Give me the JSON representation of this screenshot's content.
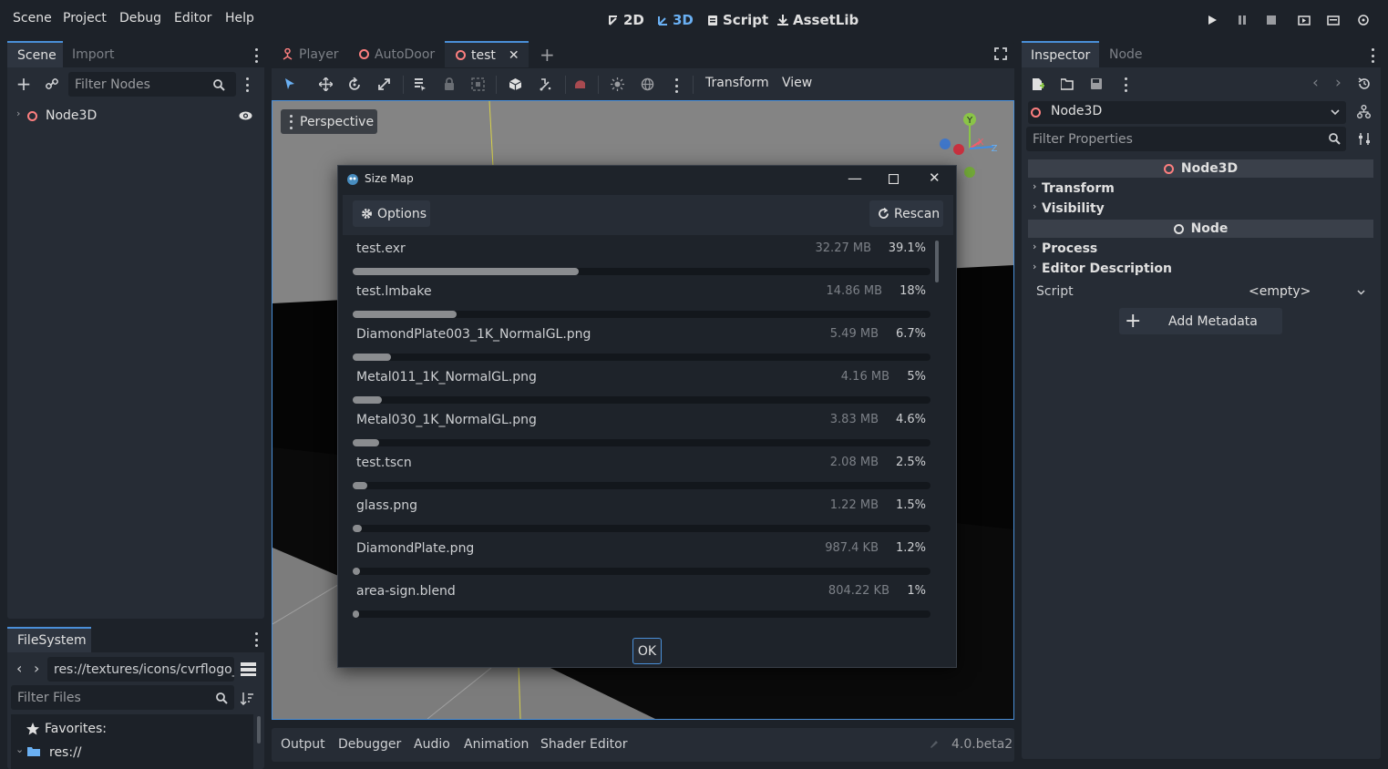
{
  "menu": [
    "Scene",
    "Project",
    "Debug",
    "Editor",
    "Help"
  ],
  "workspaces": [
    {
      "label": "2D",
      "icon": "2d-icon",
      "active": false
    },
    {
      "label": "3D",
      "icon": "3d-icon",
      "active": true
    },
    {
      "label": "Script",
      "icon": "script-icon",
      "active": false
    },
    {
      "label": "AssetLib",
      "icon": "assetlib-icon",
      "active": false
    }
  ],
  "scene_dock": {
    "tab_scene": "Scene",
    "tab_import": "Import",
    "filter_placeholder": "Filter Nodes",
    "root_node": "Node3D"
  },
  "filesystem": {
    "tab": "FileSystem",
    "path": "res://textures/icons/cvrflogo_",
    "filter_placeholder": "Filter Files",
    "favorites": "Favorites:",
    "root": "res://"
  },
  "scene_tabs": [
    {
      "label": "Player",
      "icon": "player-icon"
    },
    {
      "label": "AutoDoor",
      "icon": "node3d-icon"
    },
    {
      "label": "test",
      "icon": "node3d-icon",
      "active": true
    }
  ],
  "toolbar": {
    "transform": "Transform",
    "view": "View"
  },
  "viewport": {
    "perspective": "Perspective",
    "gizmo_y": "Y",
    "gizmo_x": "X",
    "gizmo_z": "Z"
  },
  "dialog": {
    "title": "Size Map",
    "options": "Options",
    "rescan": "Rescan",
    "ok": "OK",
    "rows": [
      {
        "name": "test.exr",
        "size": "32.27 MB",
        "pct": "39.1%",
        "fraction": 0.391
      },
      {
        "name": "test.lmbake",
        "size": "14.86 MB",
        "pct": "18%",
        "fraction": 0.18
      },
      {
        "name": "DiamondPlate003_1K_NormalGL.png",
        "size": "5.49 MB",
        "pct": "6.7%",
        "fraction": 0.067
      },
      {
        "name": "Metal011_1K_NormalGL.png",
        "size": "4.16 MB",
        "pct": "5%",
        "fraction": 0.05
      },
      {
        "name": "Metal030_1K_NormalGL.png",
        "size": "3.83 MB",
        "pct": "4.6%",
        "fraction": 0.046
      },
      {
        "name": "test.tscn",
        "size": "2.08 MB",
        "pct": "2.5%",
        "fraction": 0.025
      },
      {
        "name": "glass.png",
        "size": "1.22 MB",
        "pct": "1.5%",
        "fraction": 0.015
      },
      {
        "name": "DiamondPlate.png",
        "size": "987.4 KB",
        "pct": "1.2%",
        "fraction": 0.012
      },
      {
        "name": "area-sign.blend",
        "size": "804.22 KB",
        "pct": "1%",
        "fraction": 0.01
      }
    ]
  },
  "inspector": {
    "tab_inspector": "Inspector",
    "tab_node": "Node",
    "object": "Node3D",
    "filter_placeholder": "Filter Properties",
    "section_node3d": "Node3D",
    "cat_transform": "Transform",
    "cat_visibility": "Visibility",
    "section_node": "Node",
    "cat_process": "Process",
    "cat_editor_description": "Editor Description",
    "script_label": "Script",
    "script_value": "<empty>",
    "add_metadata": "Add Metadata"
  },
  "bottom_panel": {
    "tabs": [
      "Output",
      "Debugger",
      "Audio",
      "Animation",
      "Shader Editor"
    ],
    "version": "4.0.beta2"
  },
  "colors": {
    "accent": "#4a8fd8",
    "node3d": "#fc7f7f",
    "bg": "#1d2229",
    "panel": "#262c35"
  }
}
